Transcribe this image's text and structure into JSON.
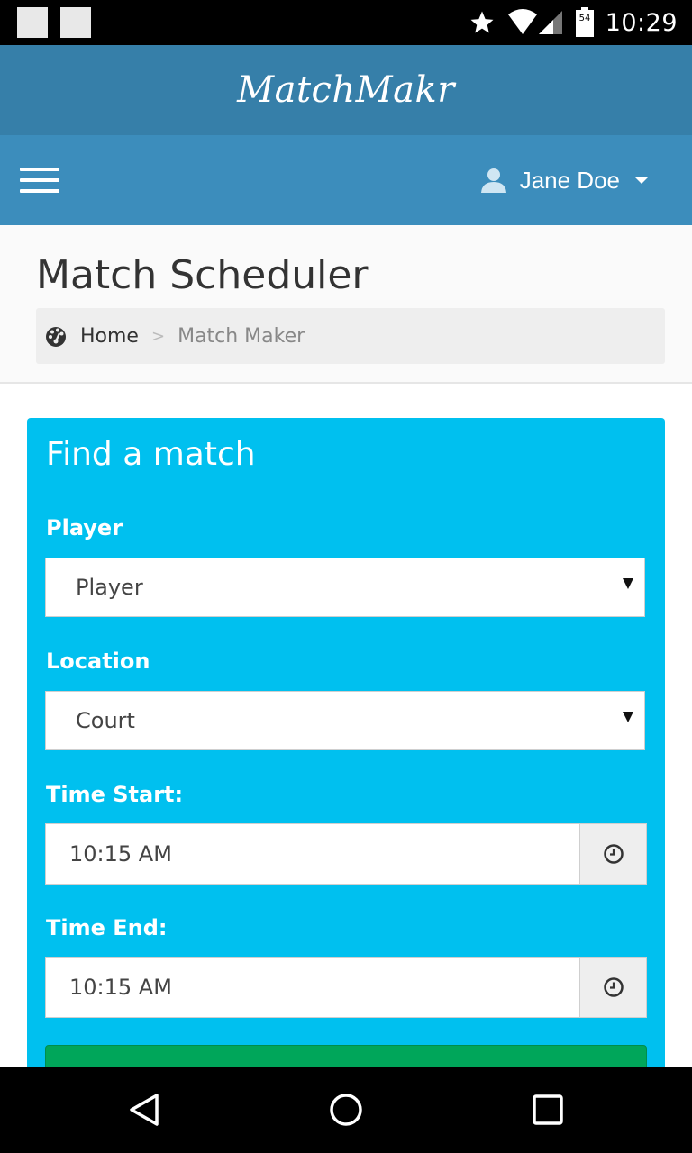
{
  "status_bar": {
    "time": "10:29",
    "battery_level": "54"
  },
  "app": {
    "brand": "MatchMakr"
  },
  "navbar": {
    "user_name": "Jane Doe"
  },
  "content_header": {
    "title": "Match Scheduler",
    "breadcrumb": {
      "home": "Home",
      "separator": ">",
      "current": "Match Maker"
    }
  },
  "form": {
    "title": "Find a match",
    "player": {
      "label": "Player",
      "selected": "Player"
    },
    "location": {
      "label": "Location",
      "selected": "Court"
    },
    "time_start": {
      "label": "Time Start:",
      "value": "10:15 AM"
    },
    "time_end": {
      "label": "Time End:",
      "value": "10:15 AM"
    }
  },
  "colors": {
    "header_dark": "#367fa9",
    "navbar": "#3c8dbc",
    "card": "#00c0ef",
    "submit": "#00a65a"
  },
  "icons": {
    "navbar_menu": "hamburger-icon",
    "user": "user-icon",
    "breadcrumb_home": "dashboard-icon",
    "time_addon": "clock-icon"
  }
}
